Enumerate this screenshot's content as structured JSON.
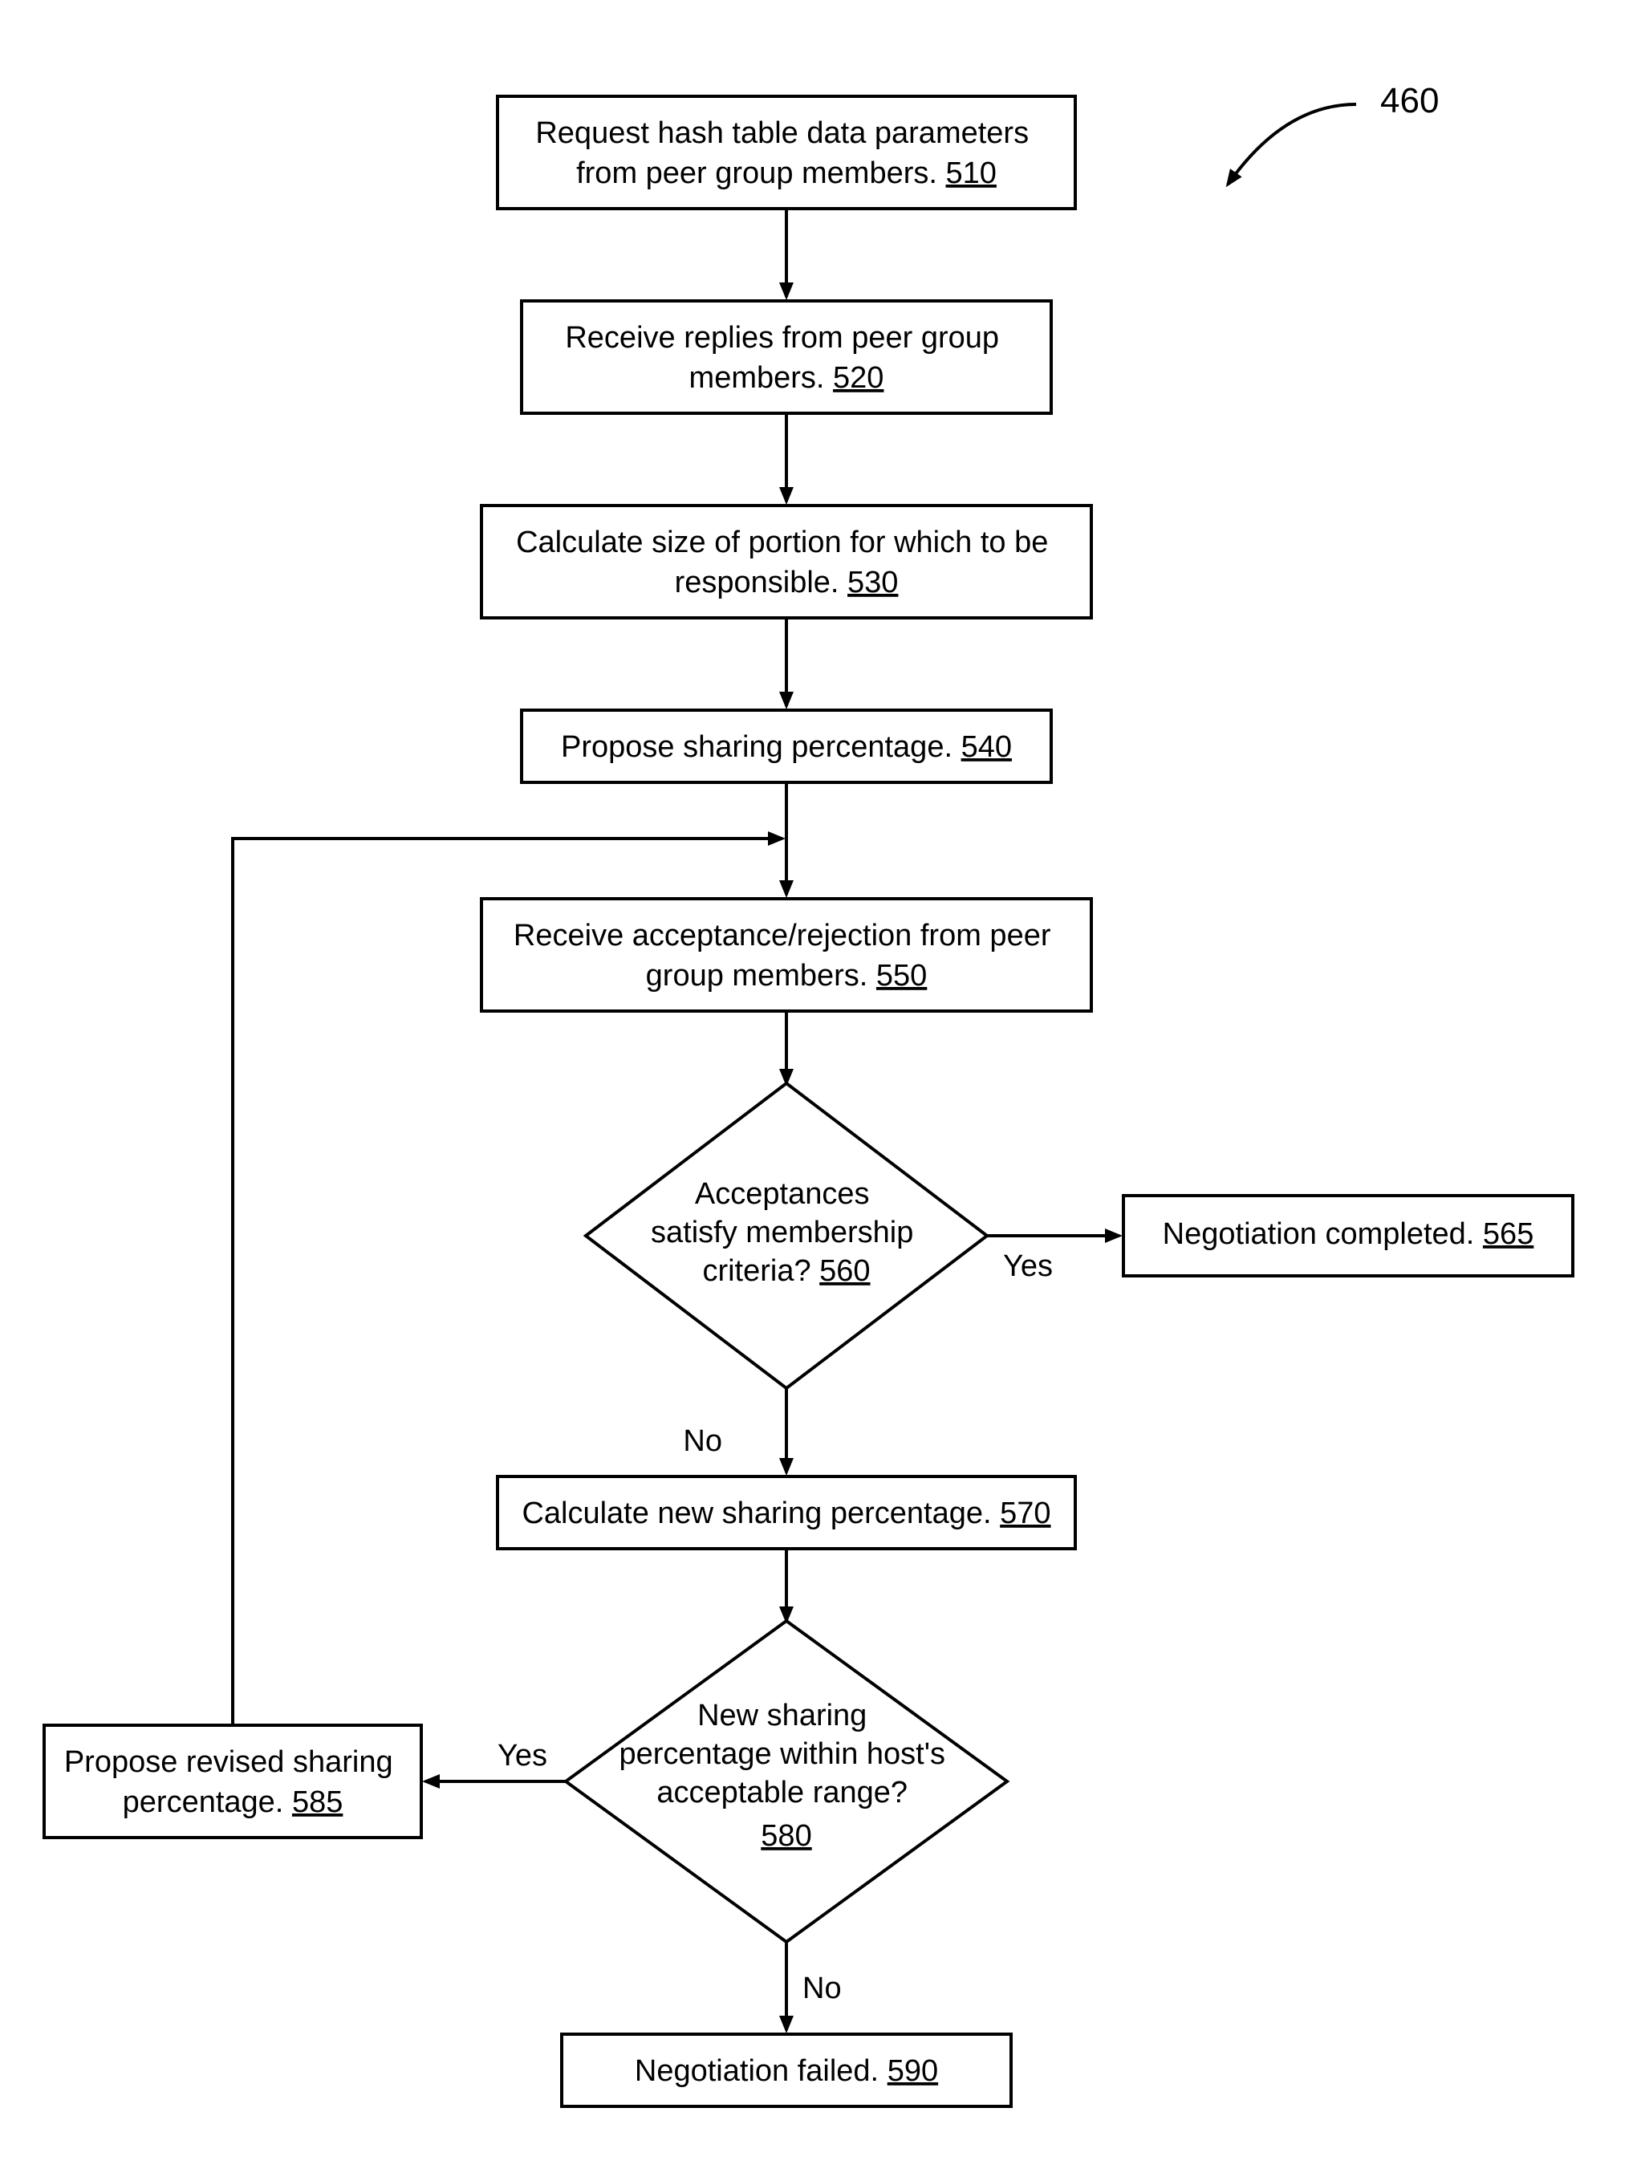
{
  "figure_ref": "460",
  "nodes": {
    "n510": {
      "text": "Request hash table data parameters from peer group members.",
      "ref": "510"
    },
    "n520": {
      "text": "Receive replies from peer group members.",
      "ref": "520"
    },
    "n530": {
      "text": "Calculate size of portion for which to be responsible.",
      "ref": "530"
    },
    "n540": {
      "text": "Propose sharing percentage.",
      "ref": "540"
    },
    "n550": {
      "text": "Receive acceptance/rejection from peer group members.",
      "ref": "550"
    },
    "n560": {
      "text": "Acceptances satisfy membership criteria?",
      "ref": "560"
    },
    "n565": {
      "text": "Negotiation completed.",
      "ref": "565"
    },
    "n570": {
      "text": "Calculate new sharing percentage.",
      "ref": "570"
    },
    "n580": {
      "text": "New sharing percentage within host's acceptable range?",
      "ref": "580"
    },
    "n585": {
      "text": "Propose revised sharing percentage.",
      "ref": "585"
    },
    "n590": {
      "text": "Negotiation failed.",
      "ref": "590"
    }
  },
  "edges": {
    "e560_yes": "Yes",
    "e560_no": "No",
    "e580_yes": "Yes",
    "e580_no": "No"
  }
}
